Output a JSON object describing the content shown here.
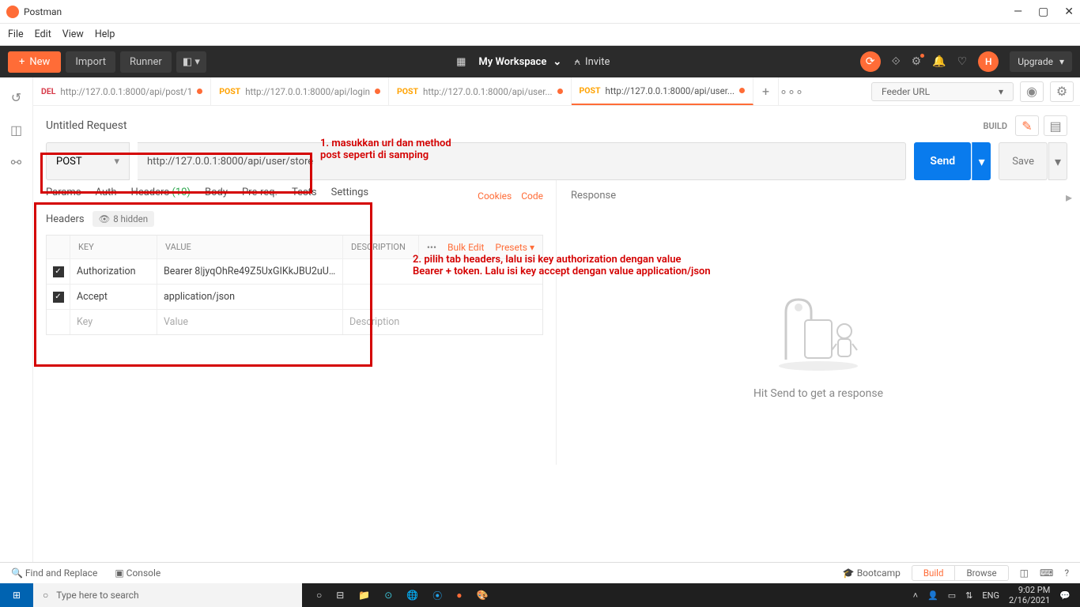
{
  "window": {
    "title": "Postman"
  },
  "menubar": [
    "File",
    "Edit",
    "View",
    "Help"
  ],
  "toolbar": {
    "new": "New",
    "import": "Import",
    "runner": "Runner",
    "workspace": "My Workspace",
    "invite": "Invite",
    "upgrade": "Upgrade",
    "user_initial": "H"
  },
  "tabs": [
    {
      "method": "DEL",
      "url": "http://127.0.0.1:8000/api/post/1",
      "dirty": true,
      "active": false
    },
    {
      "method": "POST",
      "url": "http://127.0.0.1:8000/api/login",
      "dirty": true,
      "active": false
    },
    {
      "method": "POST",
      "url": "http://127.0.0.1:8000/api/user...",
      "dirty": true,
      "active": false
    },
    {
      "method": "POST",
      "url": "http://127.0.0.1:8000/api/user...",
      "dirty": true,
      "active": true
    }
  ],
  "feeder": {
    "placeholder": "Feeder URL"
  },
  "request": {
    "title": "Untitled Request",
    "build": "BUILD",
    "method": "POST",
    "url": "http://127.0.0.1:8000/api/user/store",
    "send": "Send",
    "save": "Save"
  },
  "subtabs": {
    "params": "Params",
    "auth": "Auth",
    "headers": "Headers",
    "headers_count": "(10)",
    "body": "Body",
    "prereq": "Pre-req.",
    "tests": "Tests",
    "settings": "Settings",
    "cookies": "Cookies",
    "code": "Code"
  },
  "headers_section": {
    "title": "Headers",
    "hidden": "8 hidden",
    "cols": {
      "key": "KEY",
      "value": "VALUE",
      "desc": "DESCRIPTION"
    },
    "tools": {
      "more": "•••",
      "bulk": "Bulk Edit",
      "presets": "Presets"
    },
    "rows": [
      {
        "checked": true,
        "key": "Authorization",
        "value": "Bearer 8|jyqOhRe49Z5UxGIKkJBU2uU8..."
      },
      {
        "checked": true,
        "key": "Accept",
        "value": "application/json"
      }
    ],
    "empty": {
      "key": "Key",
      "value": "Value",
      "desc": "Description"
    }
  },
  "response": {
    "title": "Response",
    "hint": "Hit Send to get a response"
  },
  "annotations": {
    "a1_l1": "1. masukkan url dan method",
    "a1_l2": "post seperti di samping",
    "a2_l1": "2. pilih tab headers, lalu isi key authorization dengan value",
    "a2_l2": "Bearer + token. Lalu isi key accept dengan value application/json"
  },
  "statusbar": {
    "find": "Find and Replace",
    "console": "Console",
    "bootcamp": "Bootcamp",
    "build": "Build",
    "browse": "Browse"
  },
  "taskbar": {
    "search_placeholder": "Type here to search",
    "lang": "ENG",
    "time": "9:02 PM",
    "date": "2/16/2021"
  }
}
